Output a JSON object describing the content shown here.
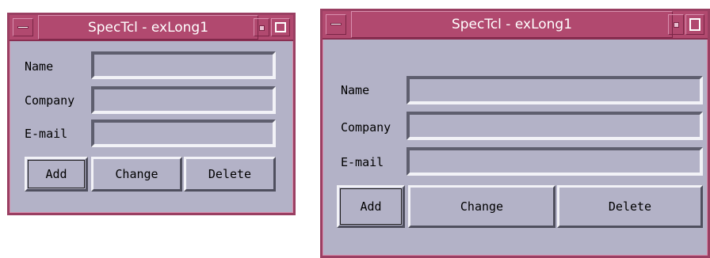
{
  "windows": [
    {
      "title": "SpecTcl - exLong1",
      "fields": [
        {
          "label": "Name",
          "value": ""
        },
        {
          "label": "Company",
          "value": ""
        },
        {
          "label": "E-mail",
          "value": ""
        }
      ],
      "buttons": [
        "Add",
        "Change",
        "Delete"
      ]
    },
    {
      "title": "SpecTcl - exLong1",
      "fields": [
        {
          "label": "Name",
          "value": ""
        },
        {
          "label": "Company",
          "value": ""
        },
        {
          "label": "E-mail",
          "value": ""
        }
      ],
      "buttons": [
        "Add",
        "Change",
        "Delete"
      ]
    }
  ],
  "theme": {
    "window_background": "#b3b2c7",
    "titlebar_color": "#b1496f",
    "frame_color": "#9a3f62",
    "title_text_color": "#ffffff"
  },
  "icons": {
    "window_menu": "window-menu-icon",
    "minimize": "minimize-icon",
    "maximize": "maximize-icon"
  }
}
